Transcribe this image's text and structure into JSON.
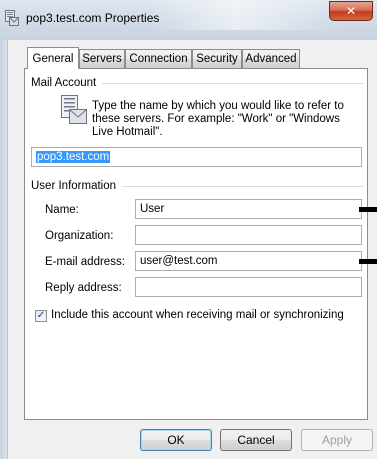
{
  "window": {
    "title": "pop3.test.com Properties",
    "close_glyph": "✕"
  },
  "tabs": [
    {
      "label": "General",
      "active": true
    },
    {
      "label": "Servers",
      "active": false
    },
    {
      "label": "Connection",
      "active": false
    },
    {
      "label": "Security",
      "active": false
    },
    {
      "label": "Advanced",
      "active": false
    }
  ],
  "mail_account": {
    "group_title": "Mail Account",
    "description": "Type the name by which you would like to refer to these servers.  For example: \"Work\" or \"Windows Live Hotmail\".",
    "account_name_value": "pop3.test.com"
  },
  "user_information": {
    "group_title": "User Information",
    "name_label": "Name:",
    "name_value": "User",
    "organization_label": "Organization:",
    "organization_value": "",
    "email_label": "E-mail address:",
    "email_value": "user@test.com",
    "reply_label": "Reply address:",
    "reply_value": ""
  },
  "include_checkbox": {
    "label": "Include this account when receiving mail or synchronizing",
    "checked": true,
    "check_glyph": "✓"
  },
  "buttons": {
    "ok_label": "OK",
    "cancel_label": "Cancel",
    "apply_label": "Apply"
  },
  "colors": {
    "selection": "#3399ff",
    "close_button": "#c03b1f"
  }
}
